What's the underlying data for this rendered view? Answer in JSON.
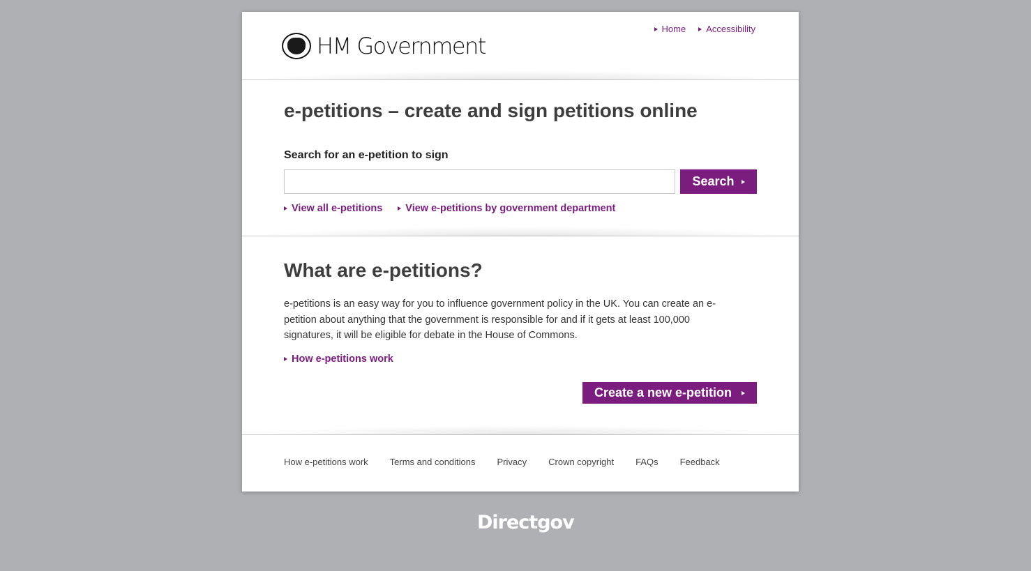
{
  "header": {
    "logo_text": "HM Government",
    "top_links": [
      {
        "label": "Home"
      },
      {
        "label": "Accessibility"
      }
    ]
  },
  "search_section": {
    "title": "e-petitions – create and sign petitions online",
    "search_label": "Search for an e-petition to sign",
    "search_value": "",
    "search_placeholder": "",
    "search_button": "Search",
    "links": [
      {
        "label": "View all e-petitions"
      },
      {
        "label": "View e-petitions by government department"
      }
    ]
  },
  "what_section": {
    "title": "What are e-petitions?",
    "body": "e-petitions is an easy way for you to influence government policy in the UK. You can create an e-petition about anything that the government is responsible for and if it gets at least 100,000 signatures, it will be eligible for debate in the House of Commons.",
    "how_link": "How e-petitions work",
    "create_button": "Create a new e-petition"
  },
  "footer": {
    "links": [
      {
        "label": "How e-petitions work"
      },
      {
        "label": "Terms and conditions"
      },
      {
        "label": "Privacy"
      },
      {
        "label": "Crown copyright"
      },
      {
        "label": "FAQs"
      },
      {
        "label": "Feedback"
      }
    ]
  },
  "brand_footer": "Directgov",
  "colors": {
    "accent": "#7a1d7e",
    "background": "#aeb0b3",
    "heading": "#3d3d3d"
  }
}
